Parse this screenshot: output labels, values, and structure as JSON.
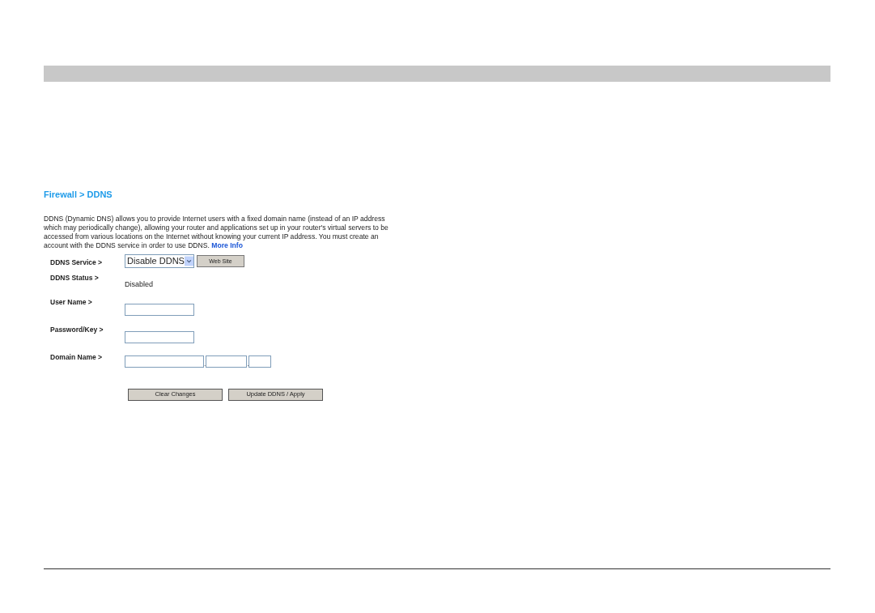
{
  "breadcrumb": "Firewall > DDNS",
  "description": {
    "text": "DDNS (Dynamic DNS) allows you to provide Internet users with a fixed domain name (instead of an IP address which may periodically change), allowing your router and applications set up in your router's virtual servers to be accessed from various locations on the Internet without knowing your current IP address. You must create an account with the DDNS service in order to use DDNS.",
    "link": "More Info"
  },
  "form": [
    {
      "kind": "select",
      "label": "DDNS Service >",
      "value": "Disable DDNS",
      "button": "Web Site"
    },
    {
      "kind": "status",
      "label": "DDNS Status >",
      "value": "Disabled"
    },
    {
      "kind": "input",
      "label": "User Name >"
    },
    {
      "kind": "input",
      "label": "Password/Key >"
    },
    {
      "kind": "domain",
      "label": "Domain Name >",
      "separator": "."
    }
  ],
  "buttons": [
    "Clear Changes",
    "Update DDNS / Apply"
  ]
}
